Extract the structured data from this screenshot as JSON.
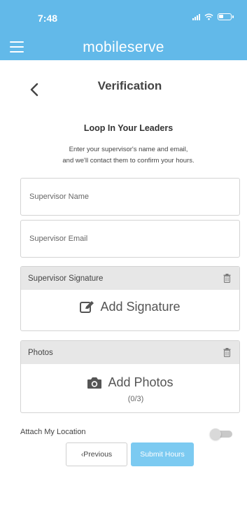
{
  "status": {
    "time": "7:48"
  },
  "app": {
    "brand": "mobileserve"
  },
  "page": {
    "title": "Verification"
  },
  "section": {
    "heading": "Loop In Your Leaders",
    "desc_line1": "Enter your supervisor's name and email,",
    "desc_line2": "and we'll contact them to confirm your hours."
  },
  "fields": {
    "supervisor_name_placeholder": "Supervisor Name",
    "supervisor_email_placeholder": "Supervisor Email"
  },
  "signature": {
    "header": "Supervisor Signature",
    "action": "Add Signature"
  },
  "photos": {
    "header": "Photos",
    "action": "Add Photos",
    "count": "(0/3)"
  },
  "location": {
    "label": "Attach My Location",
    "enabled": false
  },
  "buttons": {
    "previous": "‹Previous",
    "submit": "Submit Hours"
  },
  "colors": {
    "brand_blue": "#62b9e9",
    "submit_blue": "#7ccaf1"
  },
  "icons": {
    "menu": "hamburger-icon",
    "back": "chevron-left-icon",
    "trash": "trash-icon",
    "signature": "pencil-square-icon",
    "camera": "camera-icon"
  }
}
